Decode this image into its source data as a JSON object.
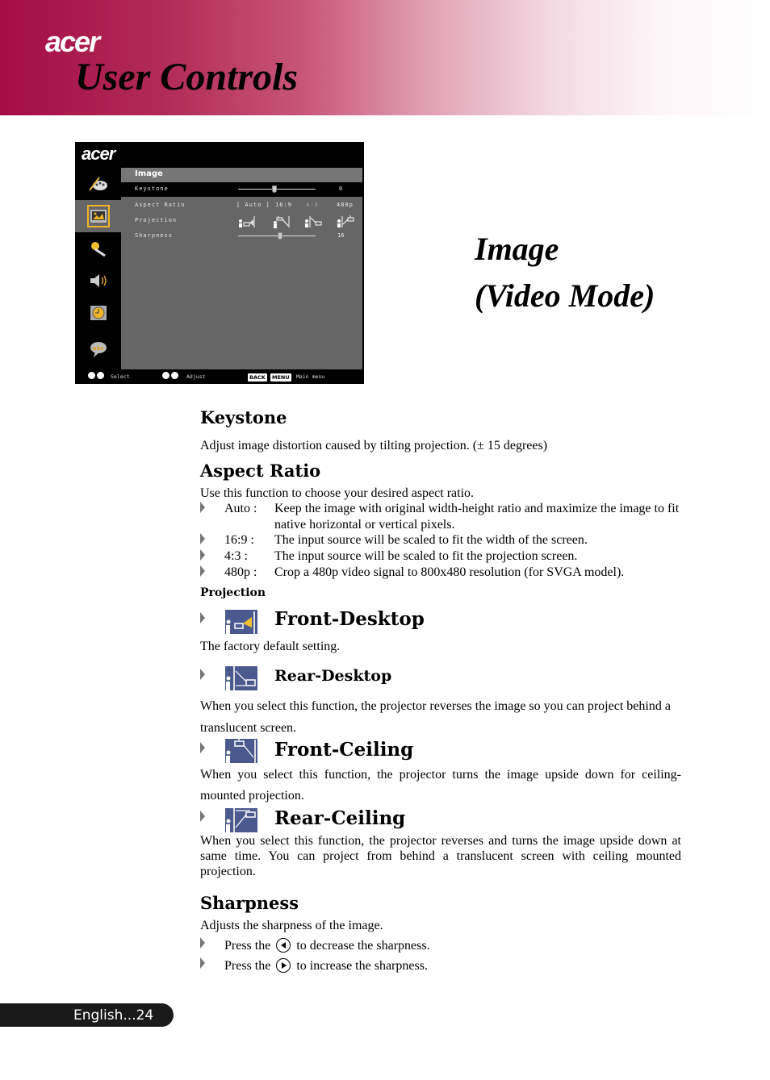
{
  "header": {
    "brand": "acer",
    "title": "User Controls",
    "gradient_start": "#a30d45",
    "gradient_end": "#ffffff"
  },
  "osd": {
    "brand": "acer",
    "menu_title": "Image",
    "sidebar_icons": [
      "color-palette-icon",
      "image-icon",
      "settings-wrench-icon",
      "speaker-icon",
      "clock-icon",
      "language-abc-icon"
    ],
    "active_sidebar_index": 1,
    "accent_color": "#f0b528",
    "rows": [
      {
        "label": "Keystone",
        "type": "slider",
        "value": "0",
        "selected": true
      },
      {
        "label": "Aspect Ratio",
        "type": "options",
        "options": [
          "[ Auto ]",
          "16:9",
          "4:3",
          "480p"
        ],
        "selected_option": "[ Auto ]"
      },
      {
        "label": "Projection",
        "type": "icons",
        "options": [
          "front-desktop-icon",
          "front-ceiling-icon",
          "rear-desktop-icon",
          "rear-ceiling-icon"
        ],
        "selected_option": "front-desktop-icon"
      },
      {
        "label": "Sharpness",
        "type": "slider",
        "value": "16"
      }
    ],
    "footer": {
      "select_label": "Select",
      "adjust_label": "Adjust",
      "back_key": "BACK",
      "menu_key": "MENU",
      "main_menu_label": "Main menu"
    }
  },
  "side_title": {
    "line1": "Image",
    "line2": "(Video Mode)"
  },
  "sections": {
    "keystone": {
      "heading": "Keystone",
      "text": "Adjust image distortion caused by tilting projection. (± 15 degrees)"
    },
    "aspect_ratio": {
      "heading": "Aspect Ratio",
      "intro": "Use this function to choose your desired aspect ratio.",
      "items": [
        {
          "label": "Auto :",
          "desc": "Keep the image with original width-height ratio and maximize the image to fit native horizontal or vertical pixels."
        },
        {
          "label": "16:9 :",
          "desc": "The input source will be scaled to fit the width of the screen."
        },
        {
          "label": "4:3 :",
          "desc": "The input source will be scaled to fit the projection screen."
        },
        {
          "label": "480p :",
          "desc": "Crop a 480p video signal to 800x480 resolution (for SVGA model)."
        }
      ]
    },
    "projection": {
      "heading": "Projection",
      "items": [
        {
          "title": "Front-Desktop",
          "icon": "front-desktop-icon",
          "desc": "The factory default setting."
        },
        {
          "title": "Rear-Desktop",
          "icon": "rear-desktop-icon",
          "desc": "When you select this function, the projector reverses the image so you can project behind a translucent screen."
        },
        {
          "title": "Front-Ceiling",
          "icon": "front-ceiling-icon",
          "desc": "When you select this function, the projector turns the image upside down for ceiling-mounted projection."
        },
        {
          "title": "Rear-Ceiling",
          "icon": "rear-ceiling-icon",
          "desc": "When you select this function, the projector reverses and turns the image upside down at same time. You can project from behind a translucent screen with ceiling mounted projection."
        }
      ],
      "icon_color": "#4a5a8e"
    },
    "sharpness": {
      "heading": "Sharpness",
      "intro": "Adjusts the sharpness of the image.",
      "items": [
        {
          "prefix": "Press the",
          "button": "left-arrow-button-icon",
          "suffix": "to decrease the sharpness."
        },
        {
          "prefix": "Press the",
          "button": "right-arrow-button-icon",
          "suffix": "to increase the sharpness."
        }
      ]
    }
  },
  "footer": {
    "page_label": "English...24"
  }
}
